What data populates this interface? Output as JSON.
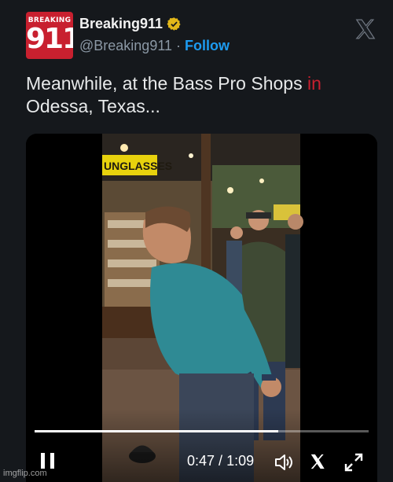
{
  "header": {
    "avatar_small": "BREAKING",
    "avatar_big": "911",
    "display_name": "Breaking911",
    "handle": "@Breaking911",
    "separator": "·",
    "follow_label": "Follow"
  },
  "tweet": {
    "text_prefix": "Meanwhile, at the Bass Pro Shops",
    "text_highlight": " in",
    "text_line2": "Odessa, Texas..."
  },
  "video": {
    "overlay_sign": "UNGLASSES",
    "progress": 0.73,
    "current_time": "0:47",
    "time_separator": " / ",
    "duration": "1:09"
  },
  "watermark": "imgflip.com",
  "colors": {
    "accent": "#1d9bf0",
    "brand_red": "#c8202f",
    "background": "#15181c"
  },
  "icons": [
    "verified-badge-icon",
    "x-logo-icon",
    "pause-icon",
    "volume-icon",
    "x-icon",
    "fullscreen-icon"
  ]
}
